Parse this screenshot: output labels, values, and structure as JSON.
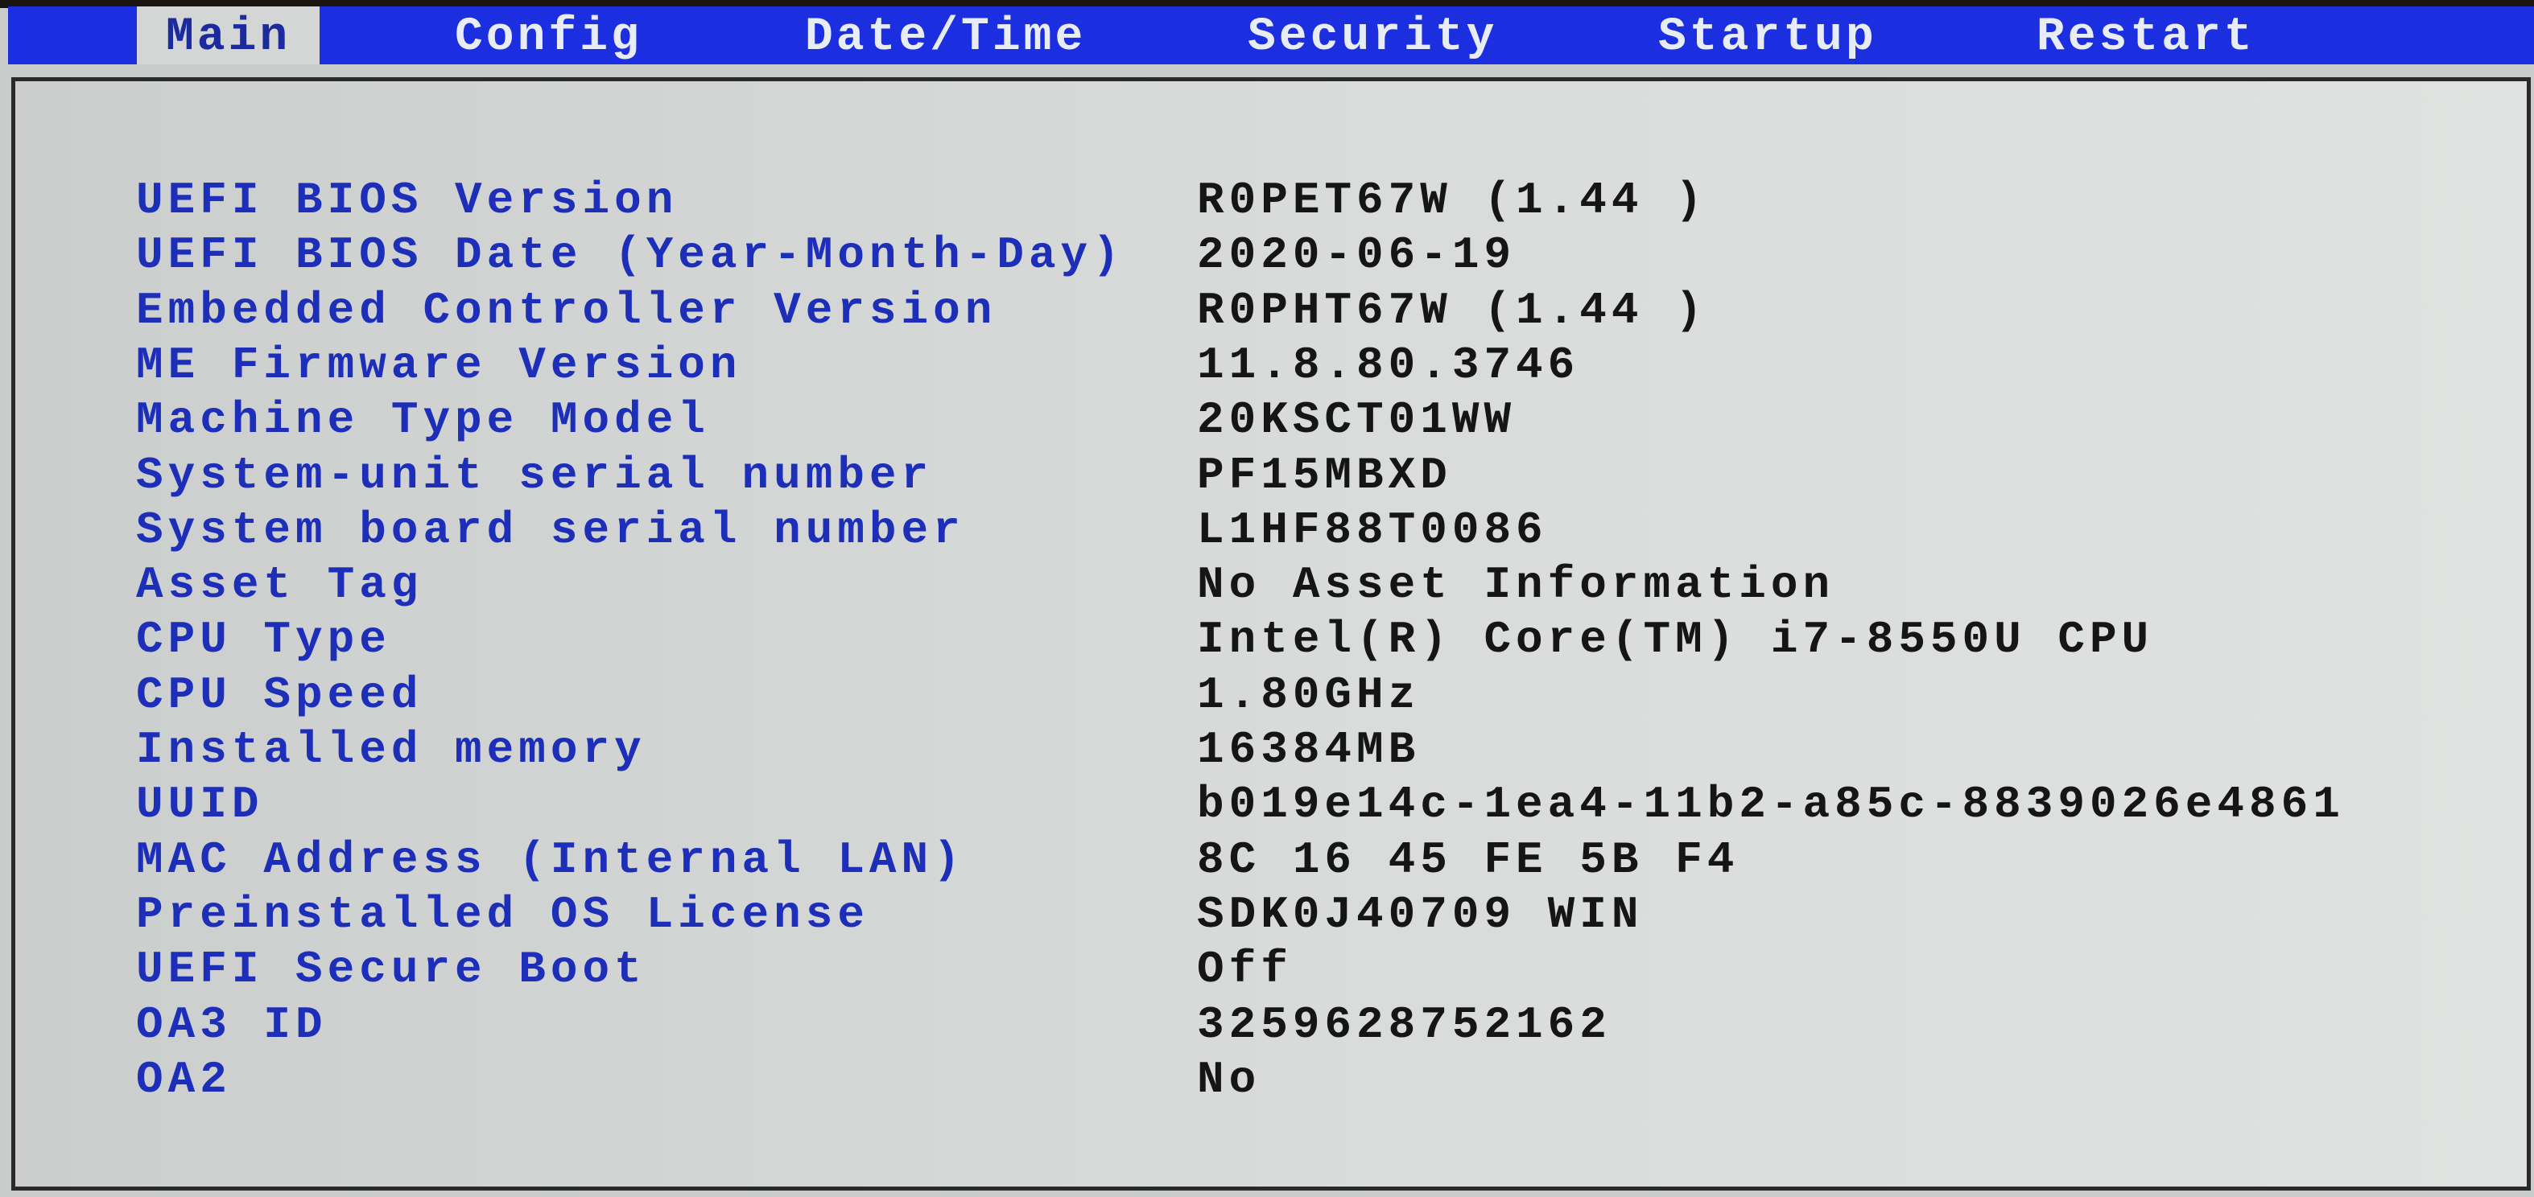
{
  "tabs": [
    {
      "label": "Main",
      "active": true
    },
    {
      "label": "Config"
    },
    {
      "label": "Date/Time"
    },
    {
      "label": "Security"
    },
    {
      "label": "Startup"
    },
    {
      "label": "Restart"
    }
  ],
  "rows": [
    {
      "label": "UEFI BIOS Version",
      "value": "R0PET67W (1.44 )"
    },
    {
      "label": "UEFI BIOS Date (Year-Month-Day)",
      "value": "2020-06-19"
    },
    {
      "label": "Embedded Controller Version",
      "value": "R0PHT67W (1.44 )"
    },
    {
      "label": "ME Firmware Version",
      "value": "11.8.80.3746"
    },
    {
      "label": "Machine Type Model",
      "value": "20KSCT01WW"
    },
    {
      "label": "System-unit serial number",
      "value": "PF15MBXD"
    },
    {
      "label": "System board serial number",
      "value": "L1HF88T0086"
    },
    {
      "label": "Asset Tag",
      "value": "No Asset Information"
    },
    {
      "label": "CPU Type",
      "value": "Intel(R) Core(TM) i7-8550U CPU"
    },
    {
      "label": "CPU Speed",
      "value": "1.80GHz"
    },
    {
      "label": "Installed memory",
      "value": "16384MB"
    },
    {
      "label": "UUID",
      "value": "b019e14c-1ea4-11b2-a85c-8839026e4861"
    },
    {
      "label": "MAC Address (Internal LAN)",
      "value": "8C 16 45 FE 5B F4"
    },
    {
      "label": "Preinstalled OS License",
      "value": "SDK0J40709 WIN"
    },
    {
      "label": "UEFI Secure Boot",
      "value": "Off"
    },
    {
      "label": "OA3 ID",
      "value": "3259628752162"
    },
    {
      "label": "OA2",
      "value": "No"
    }
  ]
}
